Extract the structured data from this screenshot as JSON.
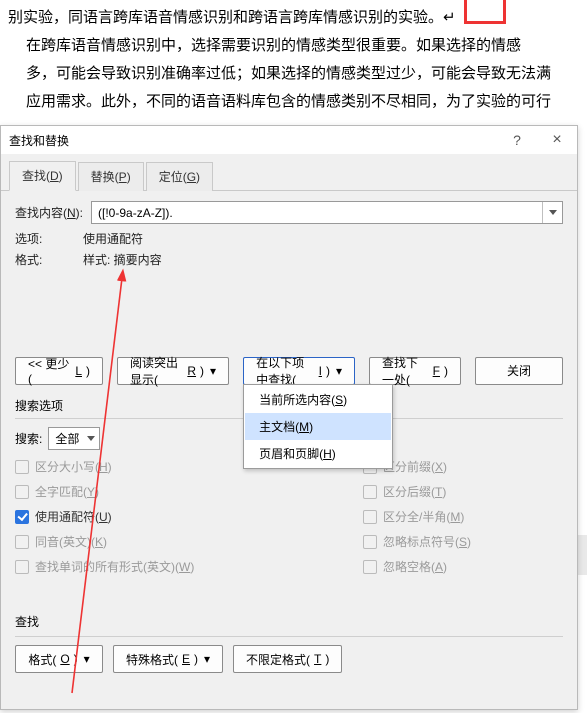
{
  "doc": {
    "line1": "别实验，同语言跨库语音情感识别和跨语言跨库情感识别的实验。↵",
    "line2": "在跨库语音情感识别中，选择需要识别的情感类型很重要。如果选择的情感",
    "line3": "多，可能会导致识别准确率过低；如果选择的情感类型过少，可能会导致无法满",
    "line4": "应用需求。此外，不同的语音语料库包含的情感类别不尽相同，为了实验的可行"
  },
  "dialog": {
    "title": "查找和替换",
    "help_tip": "?",
    "close_tip": "×",
    "tabs": {
      "find": {
        "text": "查找(",
        "key": "D",
        "suffix": ")"
      },
      "replace": {
        "text": "替换(",
        "key": "P",
        "suffix": ")"
      },
      "goto": {
        "text": "定位(",
        "key": "G",
        "suffix": ")"
      }
    },
    "find_label_text": "查找内容(",
    "find_label_key": "N",
    "find_label_suffix": "):",
    "find_value": "([!0-9a-zA-Z]).",
    "option_label": "选项:",
    "option_value": "使用通配符",
    "format_label": "格式:",
    "format_value": "样式: 摘要内容",
    "buttons": {
      "less": {
        "pre": "<< 更少(",
        "key": "L",
        "suf": ")"
      },
      "reading": {
        "pre": "阅读突出显示(",
        "key": "R",
        "suf": ")"
      },
      "find_in": {
        "pre": "在以下项中查找(",
        "key": "I",
        "suf": ")"
      },
      "find_next": {
        "pre": "查找下一处(",
        "key": "F",
        "suf": ")"
      },
      "close": "关闭"
    },
    "find_in_menu": {
      "item1": {
        "pre": "当前所选内容(",
        "key": "S",
        "suf": ")"
      },
      "item2": {
        "pre": "主文档(",
        "key": "M",
        "suf": ")"
      },
      "item3": {
        "pre": "页眉和页脚(",
        "key": "H",
        "suf": ")"
      }
    },
    "search_options_title": "搜索选项",
    "scope_label": "搜索:",
    "scope_value": "全部",
    "options_left": {
      "case": {
        "pre": "区分大小写(",
        "key": "H",
        "suf": ")"
      },
      "whole": {
        "pre": "全字匹配(",
        "key": "Y",
        "suf": ")"
      },
      "wildcard": {
        "pre": "使用通配符(",
        "key": "U",
        "suf": ")"
      },
      "homophone": {
        "pre": "同音(英文)(",
        "key": "K",
        "suf": ")"
      },
      "allforms": {
        "pre": "查找单词的所有形式(英文)(",
        "key": "W",
        "suf": ")"
      }
    },
    "options_right": {
      "prefix": {
        "pre": "区分前缀(",
        "key": "X",
        "suf": ")"
      },
      "suffix": {
        "pre": "区分后缀(",
        "key": "T",
        "suf": ")"
      },
      "width": {
        "pre": "区分全/半角(",
        "key": "M",
        "suf": ")"
      },
      "punct": {
        "pre": "忽略标点符号(",
        "key": "S",
        "suf": ")"
      },
      "space": {
        "pre": "忽略空格(",
        "key": "A",
        "suf": ")"
      }
    },
    "footer": {
      "label": "查找",
      "format": {
        "pre": "格式(",
        "key": "O",
        "suf": ")"
      },
      "special": {
        "pre": "特殊格式(",
        "key": "E",
        "suf": ")"
      },
      "noformat": {
        "pre": "不限定格式(",
        "key": "T",
        "suf": ")"
      }
    }
  }
}
